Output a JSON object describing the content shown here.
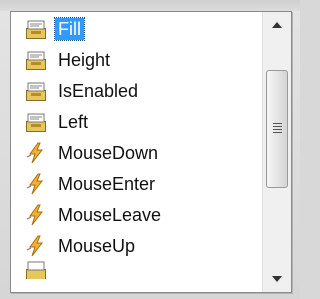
{
  "intellisense": {
    "items": [
      {
        "label": "Fill",
        "kind": "property",
        "icon": "property-icon",
        "selected": true
      },
      {
        "label": "Height",
        "kind": "property",
        "icon": "property-icon",
        "selected": false
      },
      {
        "label": "IsEnabled",
        "kind": "property",
        "icon": "property-icon",
        "selected": false
      },
      {
        "label": "Left",
        "kind": "property",
        "icon": "property-icon",
        "selected": false
      },
      {
        "label": "MouseDown",
        "kind": "event",
        "icon": "event-lightning-icon",
        "selected": false
      },
      {
        "label": "MouseEnter",
        "kind": "event",
        "icon": "event-lightning-icon",
        "selected": false
      },
      {
        "label": "MouseLeave",
        "kind": "event",
        "icon": "event-lightning-icon",
        "selected": false
      },
      {
        "label": "MouseUp",
        "kind": "event",
        "icon": "event-lightning-icon",
        "selected": false
      }
    ],
    "selected_color": "#3399ff",
    "scrollbar": {
      "up_icon": "scroll-up-arrow-icon",
      "down_icon": "scroll-down-arrow-icon"
    }
  }
}
